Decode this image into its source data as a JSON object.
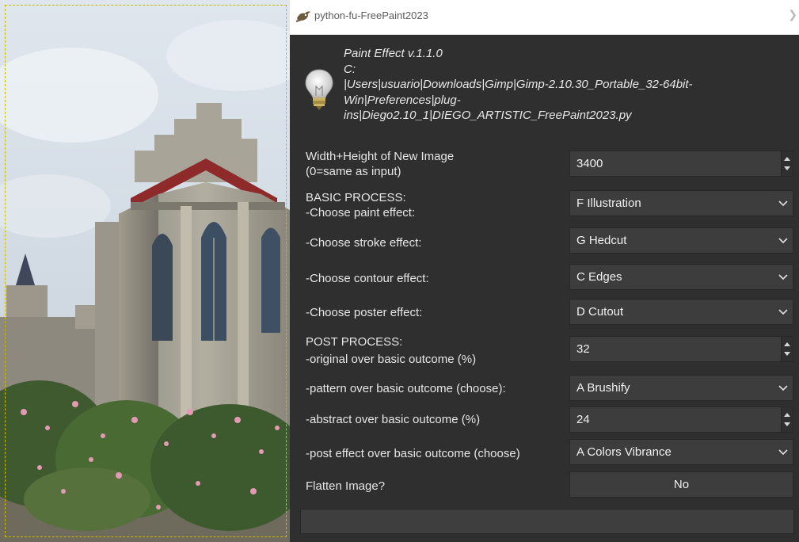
{
  "window": {
    "title": "python-fu-FreePaint2023",
    "title_icon": "gimp-wilber-icon",
    "close_icon": "close-icon"
  },
  "info": {
    "icon": "lightbulb-icon",
    "lines": [
      "Paint Effect v.1.1.0",
      "C:",
      "|Users|usuario|Downloads|Gimp|Gimp-2.10.30_Portable_32-64bit-",
      "Win|Preferences|plug-",
      "ins|Diego2.10_1|DIEGO_ARTISTIC_FreePaint2023.py"
    ]
  },
  "fields": {
    "width_height": {
      "label1": "Width+Height of New Image",
      "label2": " (0=same as input)",
      "value": "3400"
    },
    "paint_effect": {
      "label1": "BASIC PROCESS:",
      "label2": " -Choose paint effect:",
      "value": "F Illustration"
    },
    "stroke_effect": {
      "label": " -Choose stroke effect:",
      "value": "G Hedcut"
    },
    "contour_effect": {
      "label": " -Choose contour effect:",
      "value": "C Edges"
    },
    "poster_effect": {
      "label": " -Choose poster effect:",
      "value": "D Cutout"
    },
    "original_over": {
      "label1": "POST PROCESS:",
      "label2": " -original over basic outcome (%)",
      "value": "32"
    },
    "pattern_over": {
      "label": "-pattern over basic outcome (choose):",
      "value": "A Brushify"
    },
    "abstract_over": {
      "label": "-abstract over basic outcome (%)",
      "value": "24"
    },
    "post_effect": {
      "label": "-post effect over basic outcome (choose)",
      "value": "A Colors Vibrance"
    },
    "flatten": {
      "label": "Flatten Image?",
      "value": "No"
    }
  },
  "colors": {
    "dialog_bg": "#2f2f2f",
    "control_bg": "#3d3d3d",
    "text": "#e6e6e6"
  }
}
